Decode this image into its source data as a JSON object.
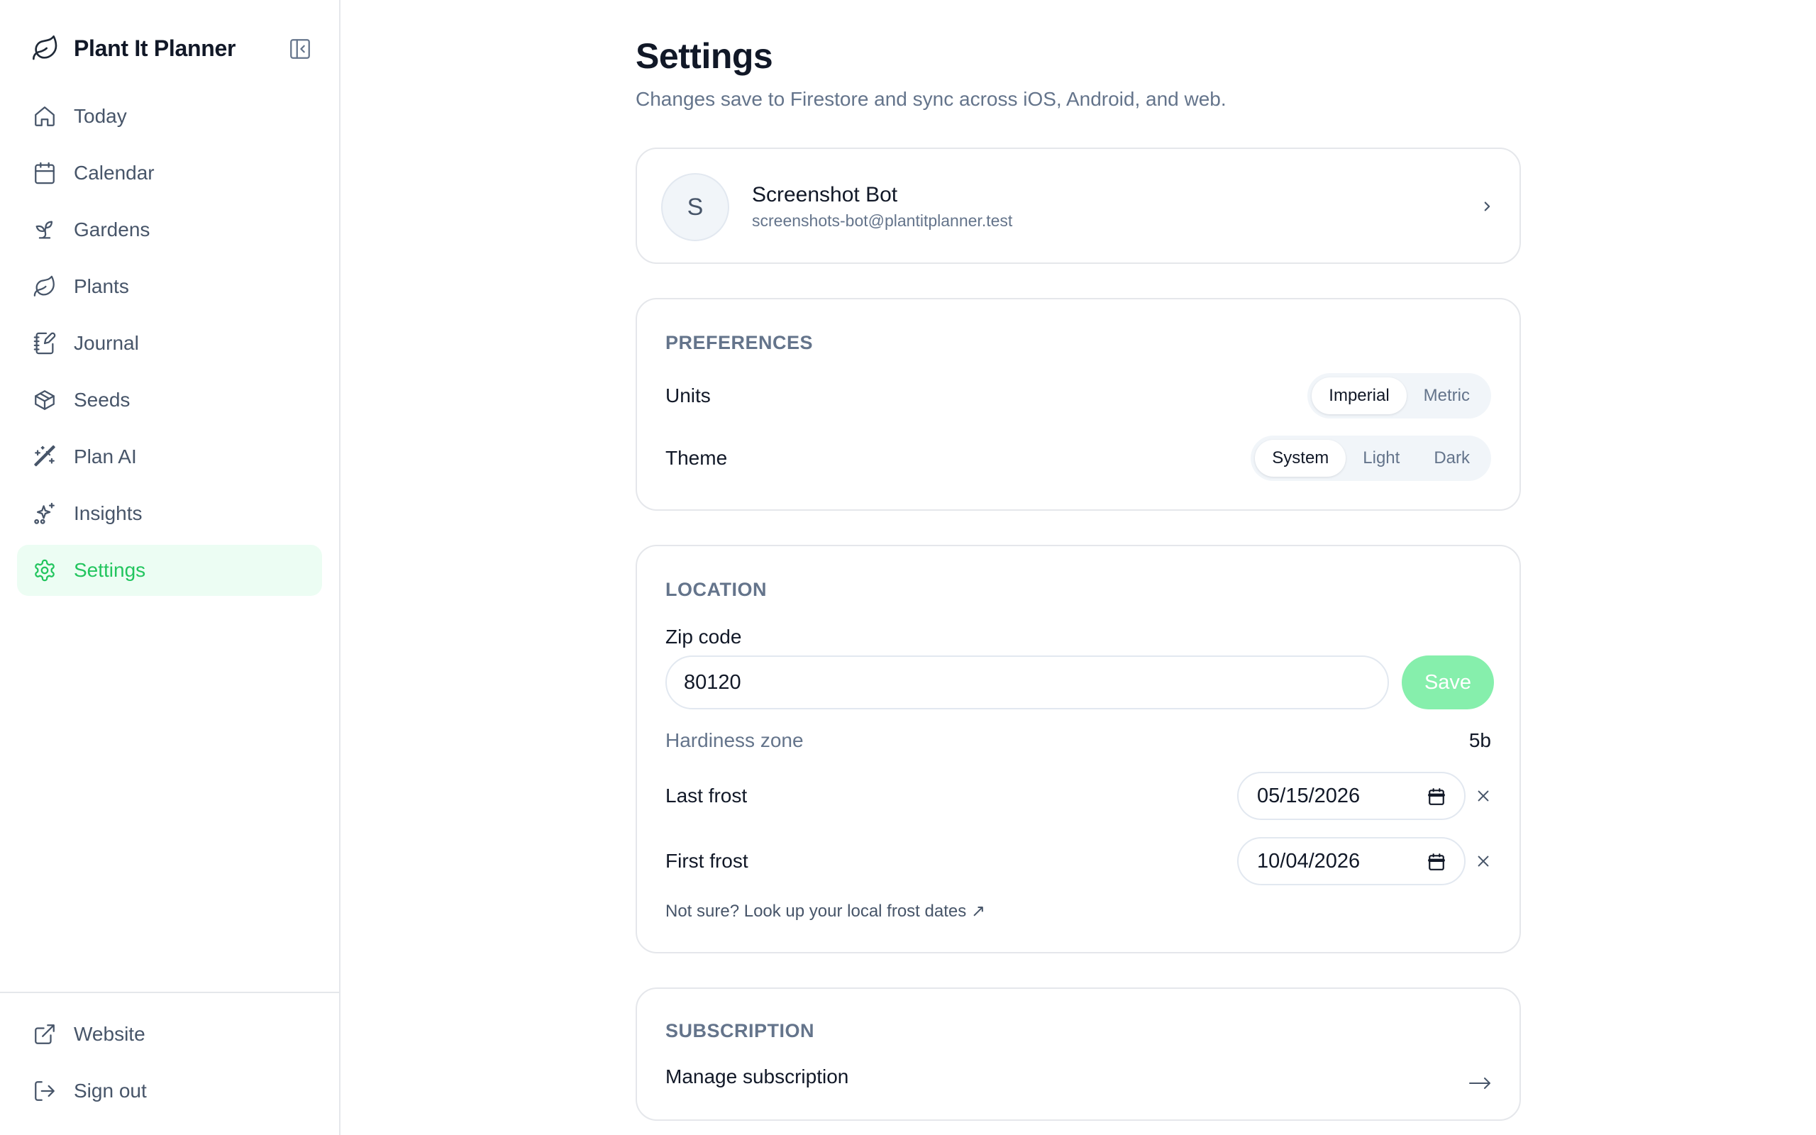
{
  "app": {
    "title": "Plant It Planner"
  },
  "nav": [
    {
      "label": "Today",
      "icon": "home-icon"
    },
    {
      "label": "Calendar",
      "icon": "calendar-icon"
    },
    {
      "label": "Gardens",
      "icon": "sprout-icon"
    },
    {
      "label": "Plants",
      "icon": "leaf-icon"
    },
    {
      "label": "Journal",
      "icon": "notebook-pen-icon"
    },
    {
      "label": "Seeds",
      "icon": "package-icon"
    },
    {
      "label": "Plan AI",
      "icon": "wand-icon"
    },
    {
      "label": "Insights",
      "icon": "sparkles-icon"
    },
    {
      "label": "Settings",
      "icon": "gear-icon",
      "active": true
    }
  ],
  "bottom_nav": [
    {
      "label": "Website",
      "icon": "external-link-icon"
    },
    {
      "label": "Sign out",
      "icon": "log-out-icon"
    }
  ],
  "page": {
    "title": "Settings",
    "subtitle": "Changes save to Firestore and sync across iOS, Android, and web."
  },
  "profile": {
    "initial": "S",
    "name": "Screenshot Bot",
    "email": "screenshots-bot@plantitplanner.test"
  },
  "preferences": {
    "heading": "PREFERENCES",
    "units": {
      "label": "Units",
      "options": [
        "Imperial",
        "Metric"
      ],
      "selected": "Imperial"
    },
    "theme": {
      "label": "Theme",
      "options": [
        "System",
        "Light",
        "Dark"
      ],
      "selected": "System"
    }
  },
  "location": {
    "heading": "LOCATION",
    "zip_label": "Zip code",
    "zip_value": "80120",
    "save_label": "Save",
    "hardiness_label": "Hardiness zone",
    "hardiness_value": "5b",
    "last_frost_label": "Last frost",
    "last_frost_value": "05/15/2026",
    "first_frost_label": "First frost",
    "first_frost_value": "10/04/2026",
    "frost_link": "Not sure? Look up your local frost dates ↗"
  },
  "subscription": {
    "heading": "SUBSCRIPTION",
    "manage_label": "Manage subscription"
  },
  "colors": {
    "accent": "#22c55e",
    "accent_bg": "#ecfdf3",
    "save_disabled": "#86efac",
    "muted": "#64748b"
  }
}
